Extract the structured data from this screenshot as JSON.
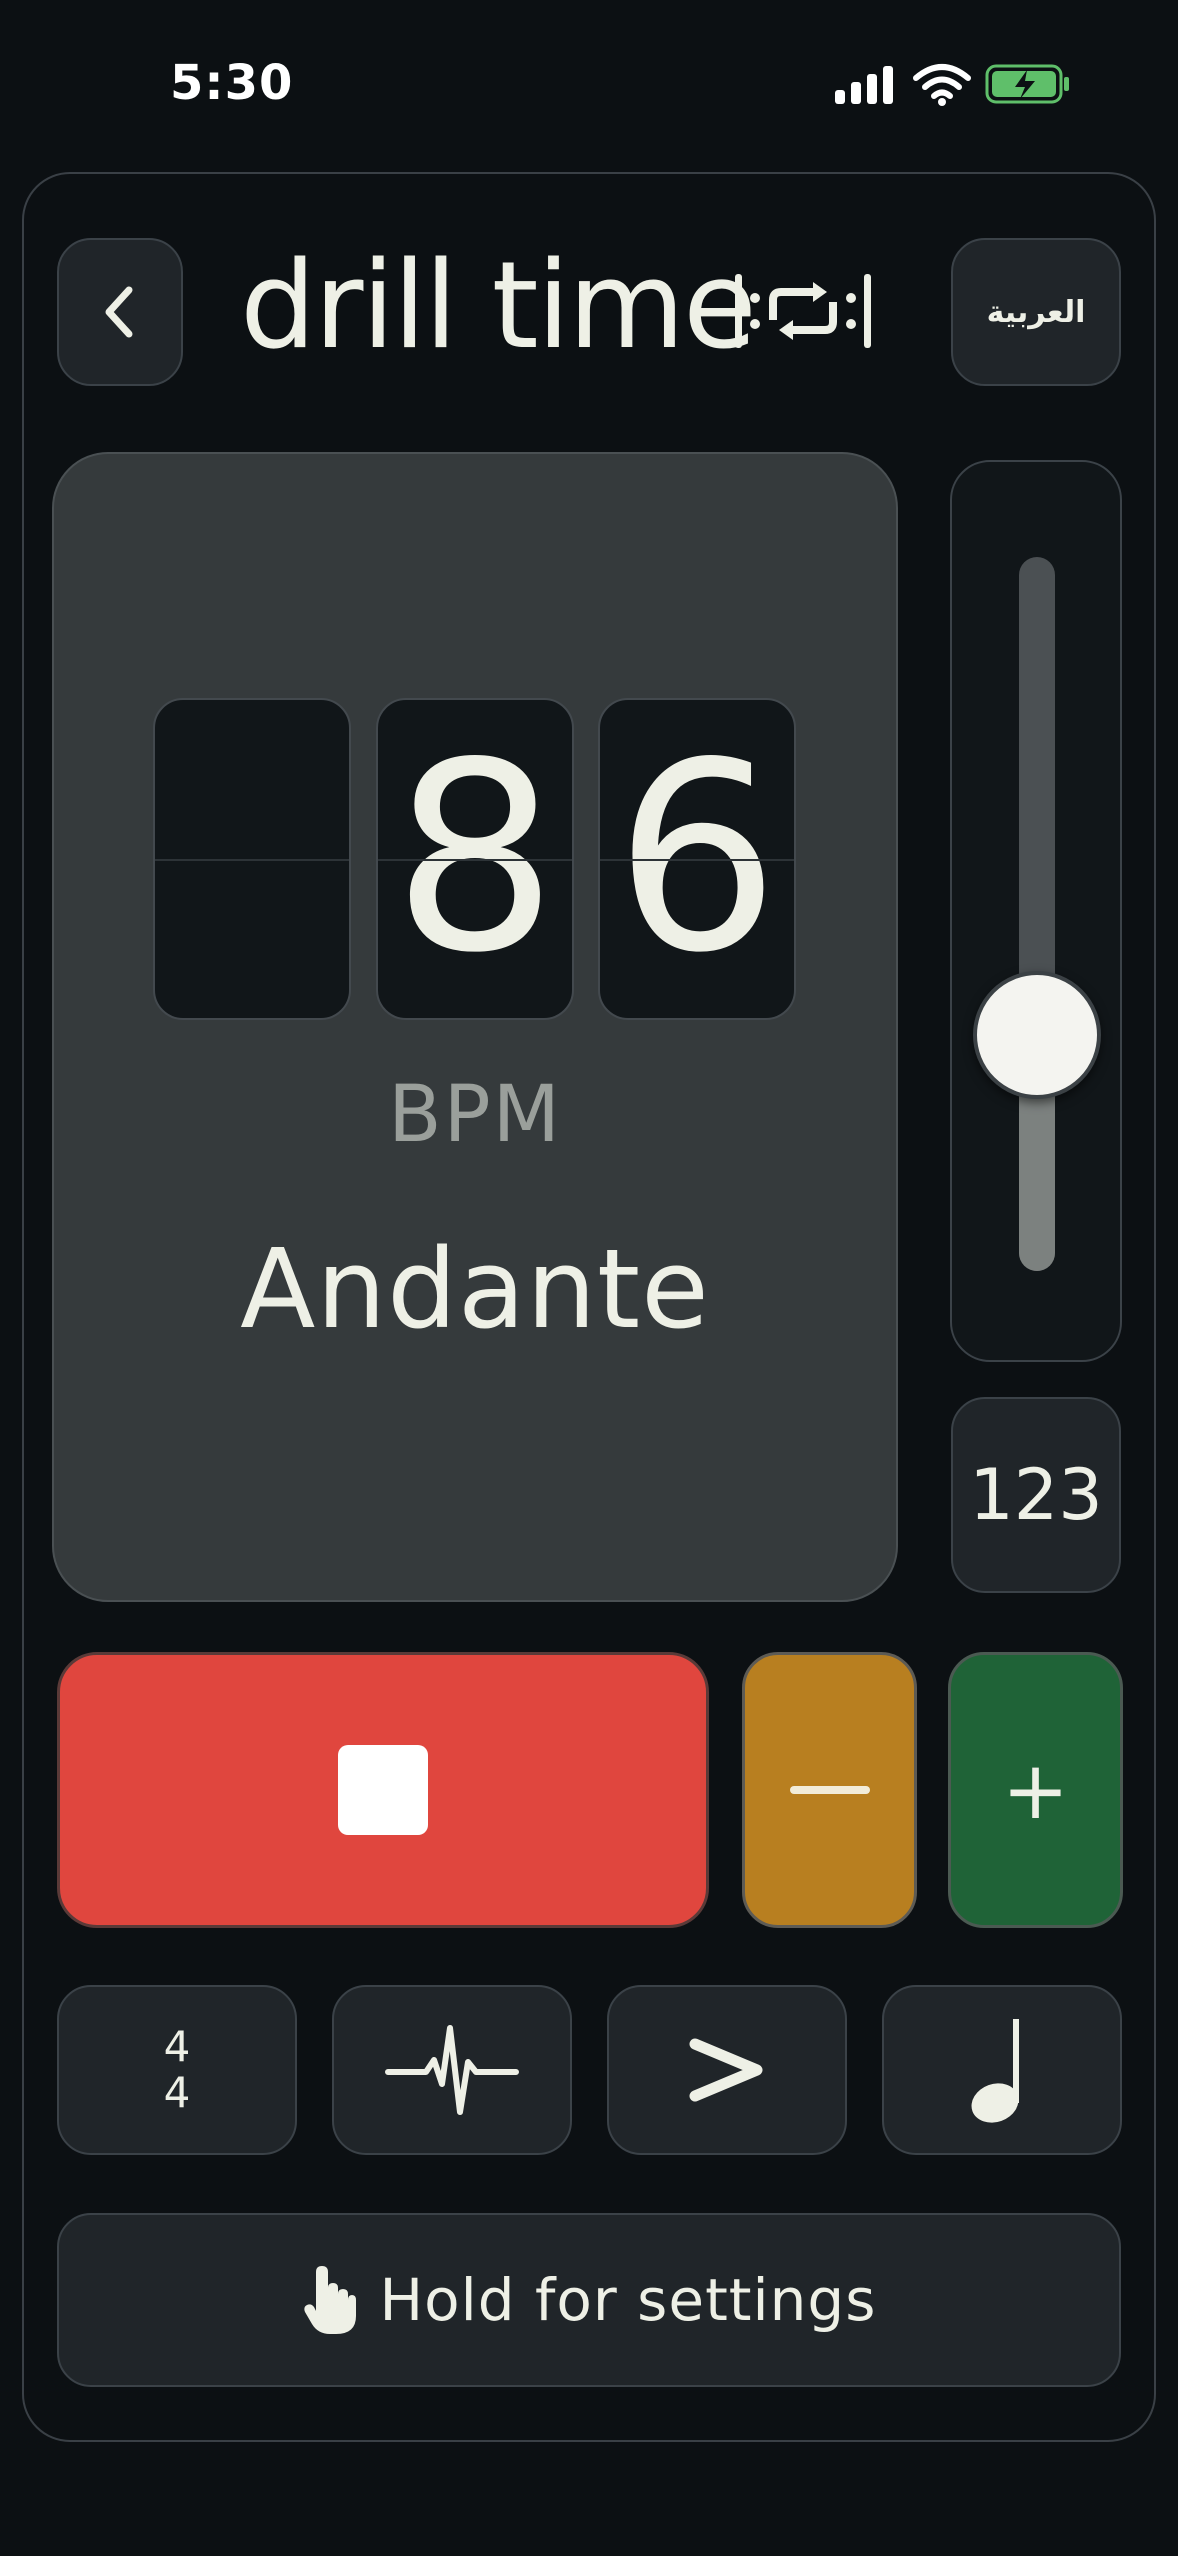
{
  "status_bar": {
    "time": "5:30",
    "icons": [
      "cellular-signal-icon",
      "wifi-icon",
      "battery-charging-icon"
    ],
    "battery_color": "#5fbf6a"
  },
  "header": {
    "back_icon": "chevron-left-icon",
    "title": "drill time",
    "logo_icon": "repeat-loop-icon",
    "language_label": "العربية"
  },
  "display": {
    "digits": [
      "",
      "8",
      "6"
    ],
    "unit": "BPM",
    "tempo_name": "Andante"
  },
  "slider": {
    "level_fraction": 0.33
  },
  "number_mode_label": "123",
  "controls": {
    "stop_icon": "stop-icon",
    "minus_icon": "minus-icon",
    "plus_label": "+",
    "colors": {
      "stop": "#e0463e",
      "minus": "#b87f20",
      "plus": "#1f6337"
    }
  },
  "tools": {
    "time_signature": {
      "top": "4",
      "bottom": "4"
    },
    "pulse_icon": "heartbeat-pulse-icon",
    "accent_icon": "accent-chevron-icon",
    "note_icon": "quarter-note-icon"
  },
  "hold": {
    "icon": "tap-hand-icon",
    "label": "Hold for settings"
  }
}
